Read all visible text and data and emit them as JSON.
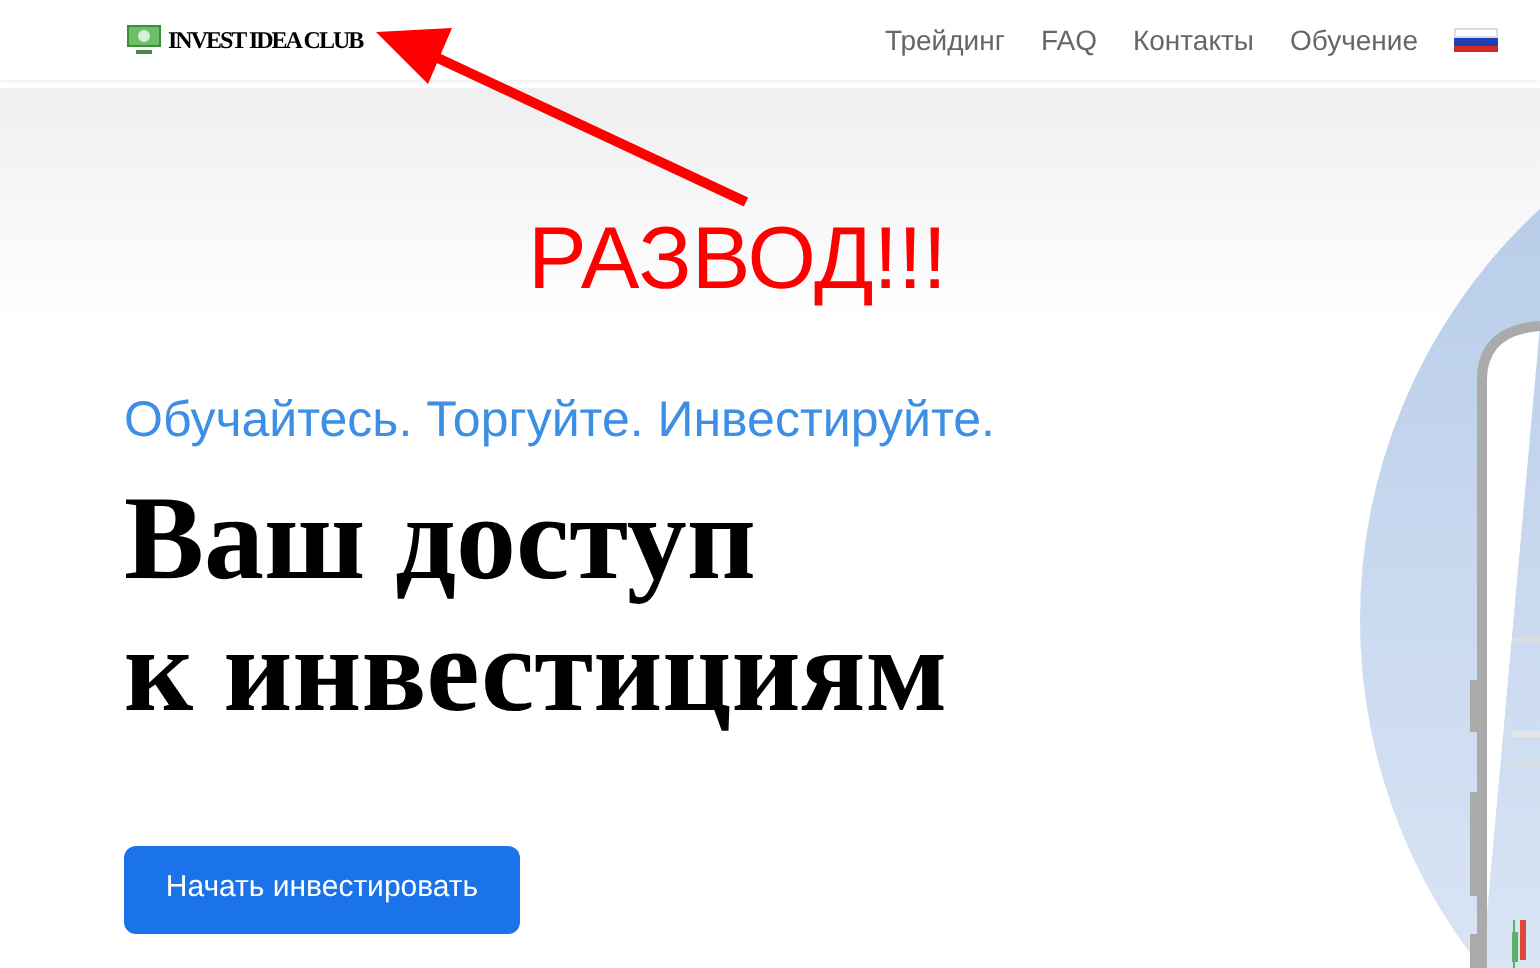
{
  "header": {
    "logo": "INVEST IDEA CLUB",
    "nav": [
      {
        "label": "Трейдинг"
      },
      {
        "label": "FAQ"
      },
      {
        "label": "Контакты"
      },
      {
        "label": "Обучение"
      }
    ]
  },
  "annotation": {
    "text": "РАЗВОД!!!"
  },
  "hero": {
    "tagline": "Обучайтесь. Торгуйте. Инвестируйте.",
    "title_lines": [
      "Ваш доступ",
      "к инвестициям"
    ],
    "button": "Начать инвестировать"
  }
}
